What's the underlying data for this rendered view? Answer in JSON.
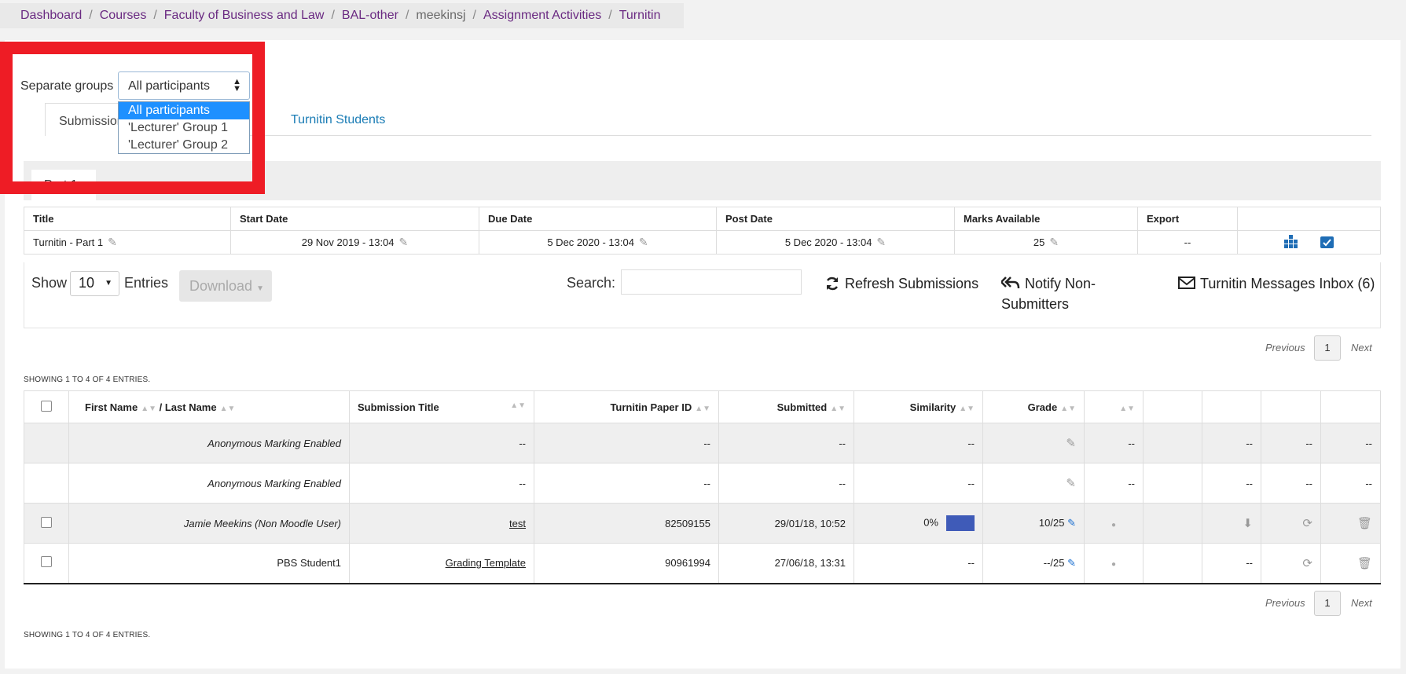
{
  "breadcrumb": [
    "Dashboard",
    "Courses",
    "Faculty of Business and Law",
    "BAL-other",
    "meekinsj",
    "Assignment Activities",
    "Turnitin"
  ],
  "groups": {
    "label": "Separate groups",
    "selected": "All participants",
    "options": [
      "All participants",
      "'Lecturer' Group 1",
      "'Lecturer' Group 2"
    ]
  },
  "tabs": {
    "submissions": "Submission",
    "students": "Turnitin Students"
  },
  "part_tab": "Part 1",
  "info_table": {
    "headers": [
      "Title",
      "Start Date",
      "Due Date",
      "Post Date",
      "Marks Available",
      "Export",
      ""
    ],
    "row": {
      "title": "Turnitin - Part 1",
      "start": "29 Nov 2019 - 13:04",
      "due": "5 Dec 2020 - 13:04",
      "post": "5 Dec 2020 - 13:04",
      "marks": "25",
      "export": "--"
    }
  },
  "controls": {
    "show": "Show",
    "entries_value": "10",
    "entries": "Entries",
    "download": "Download",
    "search": "Search:",
    "refresh": "Refresh Submissions",
    "notify": "Notify Non-Submitters",
    "notify_1": "Notify Non-",
    "notify_2": "Submitters",
    "inbox": "Turnitin Messages Inbox (6)"
  },
  "pager": {
    "previous": "Previous",
    "page": "1",
    "next": "Next"
  },
  "showing": "SHOWING 1 TO 4 OF 4 ENTRIES.",
  "submissions": {
    "headers": {
      "first": "First Name",
      "last": "/ Last Name",
      "title": "Submission Title",
      "paper": "Turnitin Paper ID",
      "submitted": "Submitted",
      "similarity": "Similarity",
      "grade": "Grade"
    },
    "rows": [
      {
        "name": "Anonymous Marking Enabled",
        "title": "--",
        "paper": "--",
        "submitted": "--",
        "similarity": "--",
        "c8": "--",
        "c10": "--",
        "c11": "--",
        "c12": "--"
      },
      {
        "name": "Anonymous Marking Enabled",
        "title": "--",
        "paper": "--",
        "submitted": "--",
        "similarity": "--",
        "c8": "--",
        "c10": "--",
        "c11": "--",
        "c12": "--"
      },
      {
        "name": "Jamie Meekins (Non Moodle User)",
        "title": "test",
        "paper": "82509155",
        "submitted": "29/01/18, 10:52",
        "similarity": "0%",
        "grade": "10/25"
      },
      {
        "name": "PBS Student1",
        "title": "Grading Template",
        "paper": "90961994",
        "submitted": "27/06/18, 13:31",
        "similarity": "--",
        "grade": "--/25",
        "c10": "--"
      }
    ]
  },
  "colors": {
    "accent": "#1a7cb5",
    "breadcrumb": "#6a2a82",
    "highlight": "#ee1c25",
    "similarity_bar": "#3f5bb8"
  }
}
